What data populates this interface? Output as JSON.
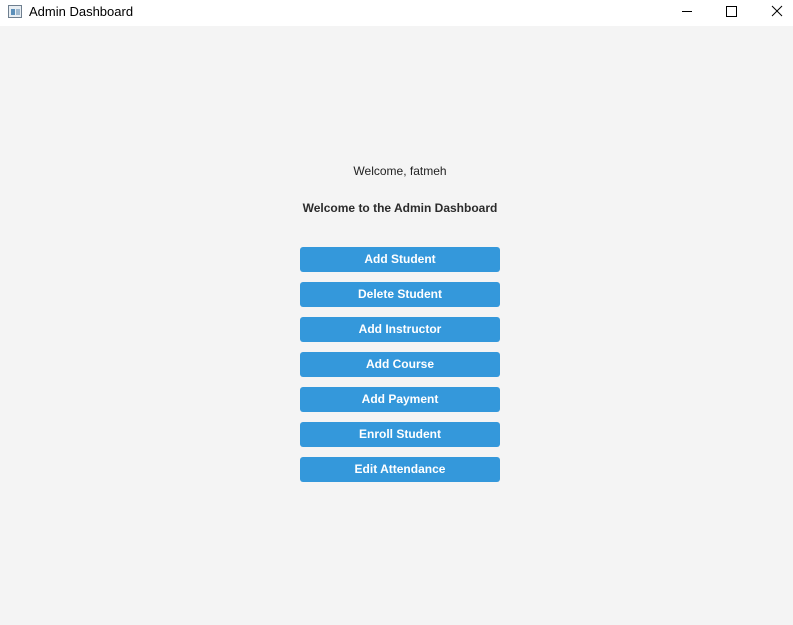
{
  "window": {
    "title": "Admin Dashboard",
    "icon": "app-window-icon",
    "controls": [
      "minimize-icon",
      "maximize-icon",
      "close-icon"
    ]
  },
  "main": {
    "welcome_text": "Welcome, fatmeh",
    "heading": "Welcome to the Admin Dashboard",
    "buttons": [
      {
        "label": "Add Student"
      },
      {
        "label": "Delete Student"
      },
      {
        "label": "Add Instructor"
      },
      {
        "label": "Add Course"
      },
      {
        "label": "Add Payment"
      },
      {
        "label": "Enroll Student"
      },
      {
        "label": "Edit Attendance"
      }
    ]
  },
  "colors": {
    "button_bg": "#3498db",
    "button_text": "#ffffff",
    "background": "#f4f4f4"
  }
}
